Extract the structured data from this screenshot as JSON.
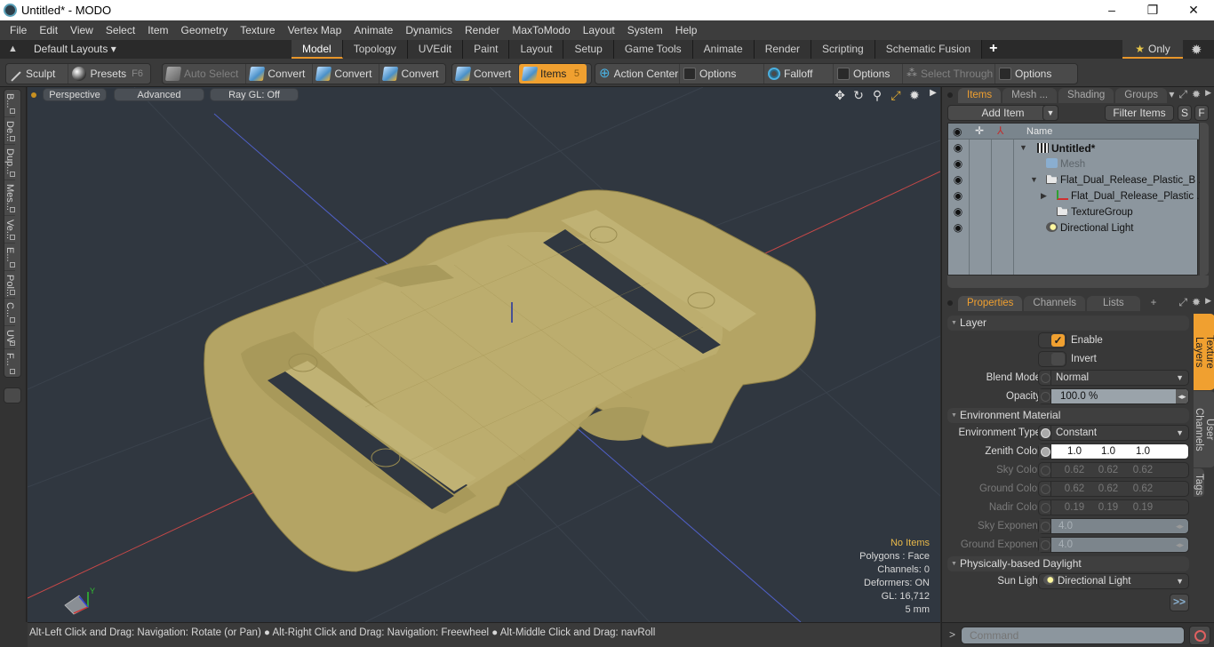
{
  "window": {
    "title": "Untitled* - MODO",
    "minimize": "–",
    "maximize": "❐",
    "close": "✕"
  },
  "menu": [
    "File",
    "Edit",
    "View",
    "Select",
    "Item",
    "Geometry",
    "Texture",
    "Vertex Map",
    "Animate",
    "Dynamics",
    "Render",
    "MaxToModo",
    "Layout",
    "System",
    "Help"
  ],
  "layoutbar": {
    "layouts_label": "Default Layouts ▾",
    "tabs": [
      "Model",
      "Topology",
      "UVEdit",
      "Paint",
      "Layout",
      "Setup",
      "Game Tools",
      "Animate",
      "Render",
      "Scripting",
      "Schematic Fusion"
    ],
    "active_tab": "Model",
    "add": "+",
    "only_label": "Only",
    "accent": "#e8962a"
  },
  "toolbar": {
    "sculpt": "Sculpt",
    "presets": "Presets",
    "presets_key": "F6",
    "auto_select": "Auto Select",
    "convert": "Convert",
    "items": "Items",
    "items_key": "5",
    "action_center": "Action Center",
    "options": "Options",
    "falloff": "Falloff",
    "select_through": "Select Through"
  },
  "leftstrip": {
    "tabs": [
      "B...",
      "De...",
      "Dup...",
      "Mes...",
      "Ve...",
      "E...",
      "Pol...",
      "C...",
      "UV",
      "F..."
    ]
  },
  "viewport": {
    "view_mode": "Perspective",
    "shading": "Advanced",
    "raygl": "Ray GL: Off",
    "info": {
      "selection": "No Items",
      "polygons": "Polygons : Face",
      "channels": "Channels: 0",
      "deformers": "Deformers: ON",
      "gl": "GL: 16,712",
      "scale": "5 mm"
    },
    "axis_label": "Y",
    "model_color": "#b8a868",
    "background": "#303740"
  },
  "status": {
    "hint1": "Alt-Left Click and Drag: Navigation: Rotate (or Pan)",
    "hint2": "Alt-Right Click and Drag: Navigation: Freewheel",
    "hint3": "Alt-Middle Click and Drag: navRoll"
  },
  "itempanel": {
    "tabs": [
      "Items",
      "Mesh ...",
      "Shading",
      "Groups"
    ],
    "active_tab": "Items",
    "add_item": "Add Item",
    "filter_items": "Filter Items",
    "s_btn": "S",
    "f_btn": "F",
    "name_col": "Name",
    "tree": [
      {
        "label": "Untitled*",
        "type": "scene",
        "expanded": true
      },
      {
        "label": "Mesh",
        "type": "mesh",
        "disabled": true
      },
      {
        "label": "Flat_Dual_Release_Plastic_B ...",
        "type": "group",
        "expanded": true
      },
      {
        "label": "Flat_Dual_Release_Plastic ...",
        "type": "locator",
        "expanded": false
      },
      {
        "label": "TextureGroup",
        "type": "group"
      },
      {
        "label": "Directional Light",
        "type": "light"
      }
    ]
  },
  "properties": {
    "tabs": [
      "Properties",
      "Channels",
      "Lists"
    ],
    "active_tab": "Properties",
    "add": "+",
    "side_tabs": [
      "Texture Layers",
      "User Channels",
      "Tags"
    ],
    "active_side_tab": "Texture Layers",
    "layer": {
      "title": "Layer",
      "enable_label": "Enable",
      "enable": true,
      "invert_label": "Invert",
      "invert": false,
      "blend_mode_label": "Blend Mode",
      "blend_mode": "Normal",
      "opacity_label": "Opacity",
      "opacity": "100.0 %"
    },
    "environment": {
      "title": "Environment Material",
      "type_label": "Environment Type",
      "type": "Constant",
      "zenith_label": "Zenith Color",
      "zenith": [
        "1.0",
        "1.0",
        "1.0"
      ],
      "sky_label": "Sky Color",
      "sky": [
        "0.62",
        "0.62",
        "0.62"
      ],
      "ground_label": "Ground Color",
      "ground": [
        "0.62",
        "0.62",
        "0.62"
      ],
      "nadir_label": "Nadir Color",
      "nadir": [
        "0.19",
        "0.19",
        "0.19"
      ],
      "sky_exp_label": "Sky Exponent",
      "sky_exp": "4.0",
      "ground_exp_label": "Ground Exponent",
      "ground_exp": "4.0"
    },
    "daylight": {
      "title": "Physically-based Daylight",
      "sun_label": "Sun Light",
      "sun": "Directional Light",
      "more": ">>"
    }
  },
  "command": {
    "prompt": ">",
    "placeholder": "Command"
  }
}
